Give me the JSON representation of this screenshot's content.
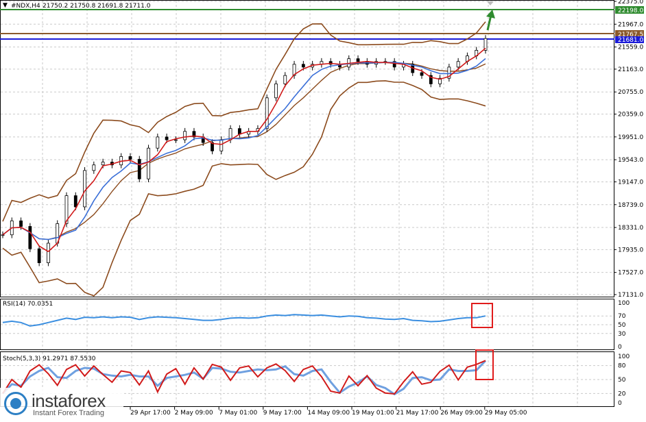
{
  "header": {
    "symbol": "#NDX,H4",
    "ohlc": "21750.2 21750.8 21691.8 21711.0"
  },
  "colors": {
    "price": "#000000",
    "ma_fast": "#d11a1a",
    "ma_slow": "#3a6fd8",
    "bands": "#8b4a1c",
    "level_resistance": "#2e8b2e",
    "level_close": "#8b5a2b",
    "level_blue": "#1a1ad8",
    "rsi": "#3a8ee0",
    "stoch_main": "#d11a1a",
    "stoch_signal": "#6fa0e0",
    "highlight": "#e01b1b",
    "grid": "#c9c9c9"
  },
  "price_axis": {
    "ticks": [
      "22375.0",
      "21967.0",
      "21559.0",
      "21163.0",
      "20755.0",
      "20359.0",
      "19951.0",
      "19543.0",
      "19147.0",
      "18739.0",
      "18331.0",
      "17935.0",
      "17527.0",
      "17131.0"
    ],
    "tag_green": "22198.0",
    "tag_brown": "21767.5",
    "tag_blue": "21681.0"
  },
  "time_axis": {
    "labels": [
      "29 Apr 17:00",
      "2 May 09:00",
      "7 May 01:00",
      "9 May 17:00",
      "14 May 09:00",
      "19 May 01:00",
      "21 May 17:00",
      "26 May 09:00",
      "29 May 05:00"
    ]
  },
  "rsi_panel": {
    "label": "RSI(14) 70.0351",
    "ticks": [
      "100",
      "70",
      "50",
      "30",
      "0"
    ]
  },
  "stoch_panel": {
    "label": "Stoch(5,3,3) 91.2971 87.5530",
    "ticks": [
      "100",
      "80",
      "50",
      "20",
      "0"
    ]
  },
  "watermark": {
    "name": "instaforex",
    "tagline": "Instant Forex Trading"
  },
  "chart_data": [
    {
      "type": "line",
      "title": "#NDX,H4",
      "ylim": [
        17131,
        22375
      ],
      "series": [
        {
          "values": [
            18200,
            18450,
            18350,
            17950,
            17700,
            18050,
            18400,
            18900,
            18700,
            19350,
            19450,
            19500,
            19450,
            19600,
            19550,
            19200,
            19750,
            19950,
            19900,
            19900,
            20050,
            19950,
            19850,
            19700,
            19900,
            20100,
            20000,
            20050,
            20100,
            20650,
            20900,
            21050,
            21250,
            21200,
            21250,
            21300,
            21250,
            21200,
            21350,
            21300,
            21250,
            21300,
            21300,
            21200,
            21250,
            21100,
            21050,
            20900,
            21000,
            21200,
            21300,
            21400,
            21500,
            21711
          ]
        }
      ]
    },
    {
      "type": "line",
      "title": "RSI(14) 70.0351",
      "ylim": [
        0,
        100
      ],
      "series": [
        {
          "values": [
            55,
            58,
            55,
            47,
            50,
            55,
            60,
            65,
            62,
            67,
            66,
            68,
            66,
            68,
            67,
            62,
            66,
            68,
            67,
            66,
            64,
            62,
            60,
            60,
            62,
            65,
            66,
            65,
            66,
            70,
            72,
            71,
            73,
            72,
            71,
            72,
            70,
            68,
            70,
            69,
            66,
            65,
            63,
            62,
            64,
            60,
            59,
            57,
            58,
            61,
            64,
            66,
            66,
            70
          ]
        }
      ]
    },
    {
      "type": "line",
      "title": "Stoch(5,3,3) 91.2971 87.5530",
      "ylim": [
        0,
        100
      ],
      "series": [
        {
          "values": [
            20,
            60,
            30,
            80,
            95,
            50,
            20,
            90,
            95,
            40,
            85,
            60,
            30,
            80,
            70,
            20,
            80,
            10,
            70,
            90,
            20,
            85,
            50,
            90,
            80,
            30,
            85,
            90,
            40,
            80,
            95,
            60,
            30,
            85,
            90,
            40,
            5,
            20,
            80,
            30,
            60,
            25,
            10,
            20,
            60,
            80,
            25,
            40,
            85,
            90,
            30,
            85,
            95,
            91
          ]
        }
      ]
    }
  ]
}
